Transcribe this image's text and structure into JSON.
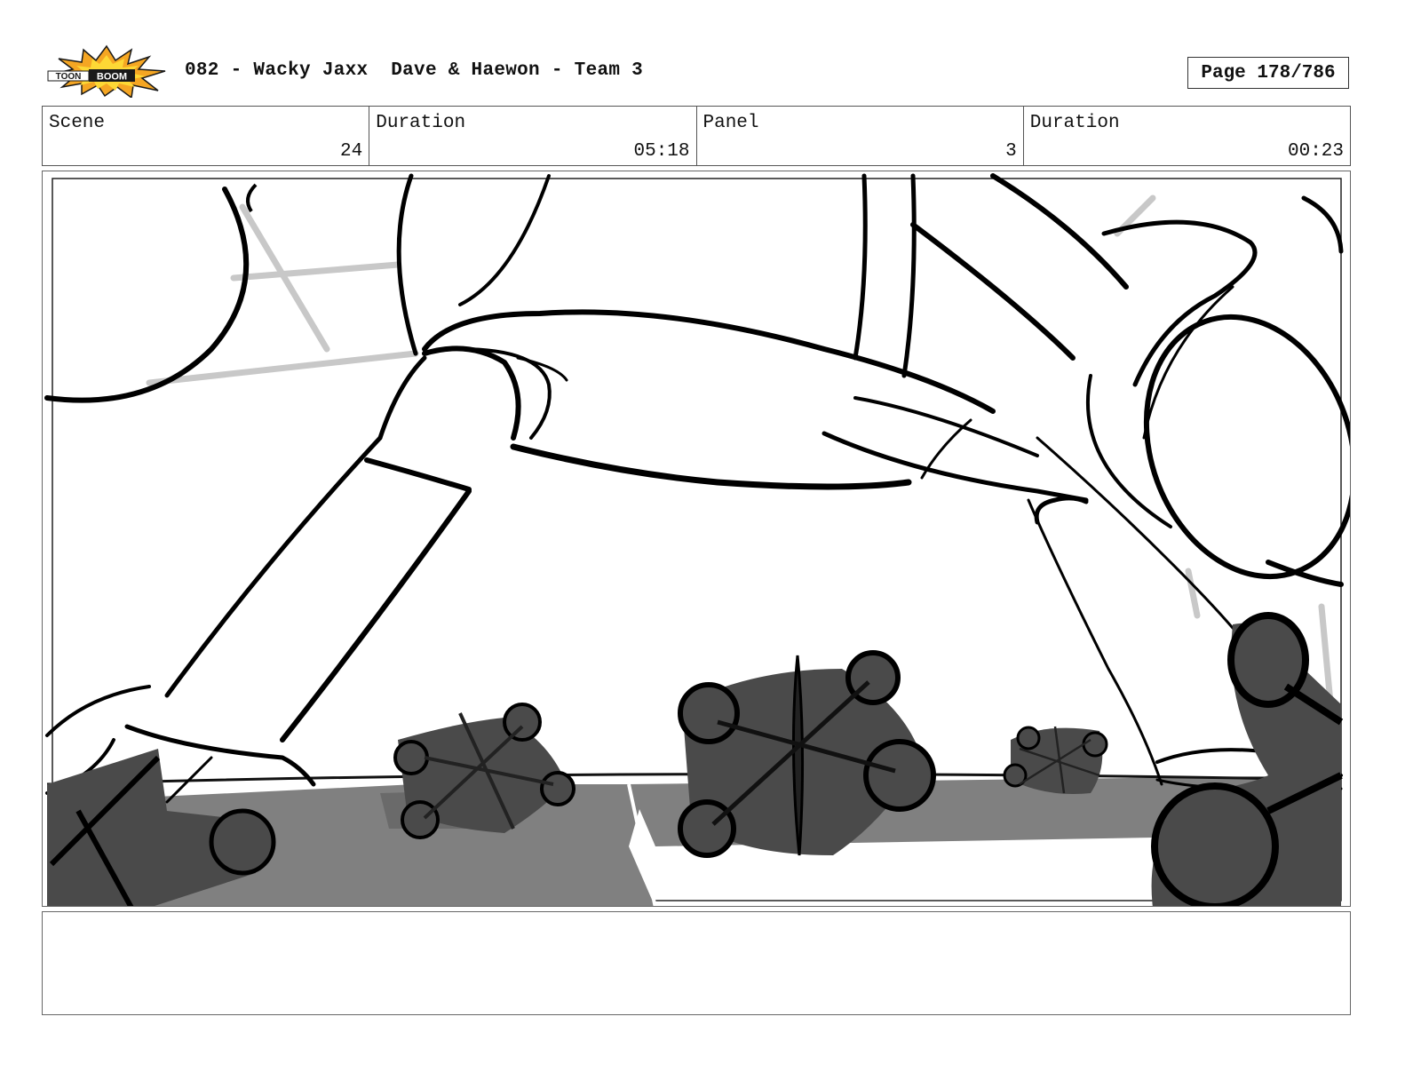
{
  "logo": {
    "text": "TOON BOOM",
    "colors": {
      "burst": "#f5a623",
      "burst_inner": "#fdd835",
      "outline": "#1a1a1a"
    }
  },
  "header": {
    "title": "082 - Wacky Jaxx  Dave & Haewon - Team 3",
    "page": "Page 178/786"
  },
  "info": {
    "scene_label": "Scene",
    "scene_value": "24",
    "duration_label": "Duration",
    "duration_value": "05:18",
    "panel_label": "Panel",
    "panel_value": "3",
    "panel_duration_label": "Duration",
    "panel_duration_value": "00:23"
  },
  "artwork": {
    "description_icon": "storyboard-sketch",
    "colors": {
      "line": "#000000",
      "shadow": "#808080",
      "jack": "#4a4a4a",
      "guide": "#c8c8c8"
    }
  },
  "notes": {
    "text": ""
  }
}
